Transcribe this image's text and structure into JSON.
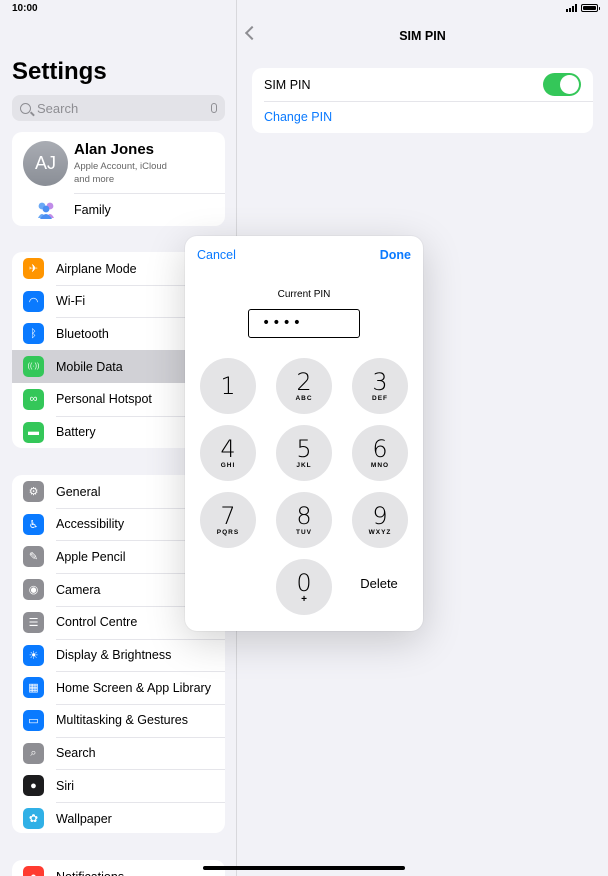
{
  "status_bar": {
    "time": "10:00"
  },
  "sidebar": {
    "title": "Settings",
    "search_placeholder": "Search",
    "profile": {
      "initials": "AJ",
      "name": "Alan Jones",
      "subtitle": "Apple Account, iCloud and more",
      "family_label": "Family"
    },
    "group1": [
      {
        "label": "Airplane Mode",
        "icon": "airplane-icon",
        "color": "#ff9500"
      },
      {
        "label": "Wi-Fi",
        "icon": "wifi-icon",
        "color": "#0a7aff"
      },
      {
        "label": "Bluetooth",
        "icon": "bluetooth-icon",
        "color": "#0a7aff"
      },
      {
        "label": "Mobile Data",
        "icon": "antenna-icon",
        "color": "#34c759",
        "selected": true
      },
      {
        "label": "Personal Hotspot",
        "icon": "hotspot-icon",
        "color": "#34c759"
      },
      {
        "label": "Battery",
        "icon": "battery-icon",
        "color": "#34c759"
      }
    ],
    "group2": [
      {
        "label": "General",
        "icon": "gear-icon",
        "color": "#8e8e93"
      },
      {
        "label": "Accessibility",
        "icon": "accessibility-icon",
        "color": "#0a7aff"
      },
      {
        "label": "Apple Pencil",
        "icon": "pencil-icon",
        "color": "#8e8e93"
      },
      {
        "label": "Camera",
        "icon": "camera-icon",
        "color": "#8e8e93"
      },
      {
        "label": "Control Centre",
        "icon": "switches-icon",
        "color": "#8e8e93"
      },
      {
        "label": "Display & Brightness",
        "icon": "sun-icon",
        "color": "#0a7aff"
      },
      {
        "label": "Home Screen & App Library",
        "icon": "home-screen-icon",
        "color": "#0a7aff"
      },
      {
        "label": "Multitasking & Gestures",
        "icon": "multitasking-icon",
        "color": "#0a7aff"
      },
      {
        "label": "Search",
        "icon": "search-icon",
        "color": "#8e8e93"
      },
      {
        "label": "Siri",
        "icon": "siri-icon",
        "color": "#1c1c1e"
      },
      {
        "label": "Wallpaper",
        "icon": "flower-icon",
        "color": "#30b0e6"
      }
    ],
    "group3": [
      {
        "label": "Notifications",
        "icon": "notifications-icon",
        "color": "#ff3b30"
      }
    ]
  },
  "detail": {
    "title": "SIM PIN",
    "sim_pin_label": "SIM PIN",
    "sim_pin_enabled": true,
    "change_pin_label": "Change PIN"
  },
  "pin_popover": {
    "cancel_label": "Cancel",
    "done_label": "Done",
    "prompt": "Current PIN",
    "masked_value": "••••",
    "keys": [
      {
        "digit": "1",
        "letters": ""
      },
      {
        "digit": "2",
        "letters": "ABC"
      },
      {
        "digit": "3",
        "letters": "DEF"
      },
      {
        "digit": "4",
        "letters": "GHI"
      },
      {
        "digit": "5",
        "letters": "JKL"
      },
      {
        "digit": "6",
        "letters": "MNO"
      },
      {
        "digit": "7",
        "letters": "PQRS"
      },
      {
        "digit": "8",
        "letters": "TUV"
      },
      {
        "digit": "9",
        "letters": "WXYZ"
      },
      {
        "digit": "0",
        "letters": "+"
      }
    ],
    "delete_label": "Delete"
  }
}
